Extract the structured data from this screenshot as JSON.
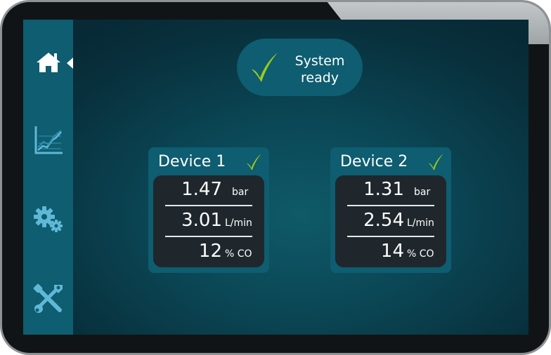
{
  "status": {
    "line1": "System",
    "line2": "ready",
    "icon": "check-icon",
    "color": "#9ccc1c"
  },
  "sidebar": {
    "items": [
      {
        "name": "home",
        "icon": "home-icon",
        "active": true
      },
      {
        "name": "chart",
        "icon": "line-chart-icon",
        "active": false
      },
      {
        "name": "settings",
        "icon": "gears-icon",
        "active": false
      },
      {
        "name": "tools",
        "icon": "tools-icon",
        "active": false
      }
    ]
  },
  "devices": [
    {
      "title": "Device 1",
      "ok": true,
      "readings": [
        {
          "value": "1.47",
          "unit": "bar"
        },
        {
          "value": "3.01",
          "unit": "L/min"
        },
        {
          "value": "12",
          "unit": "% CO"
        }
      ]
    },
    {
      "title": "Device 2",
      "ok": true,
      "readings": [
        {
          "value": "1.31",
          "unit": "bar"
        },
        {
          "value": "2.54",
          "unit": "L/min"
        },
        {
          "value": "14",
          "unit": "% CO"
        }
      ]
    }
  ],
  "colors": {
    "accent": "#0e5d70",
    "ok": "#9ccc1c",
    "icon": "#5fb8d6",
    "panel": "#1f272c"
  }
}
